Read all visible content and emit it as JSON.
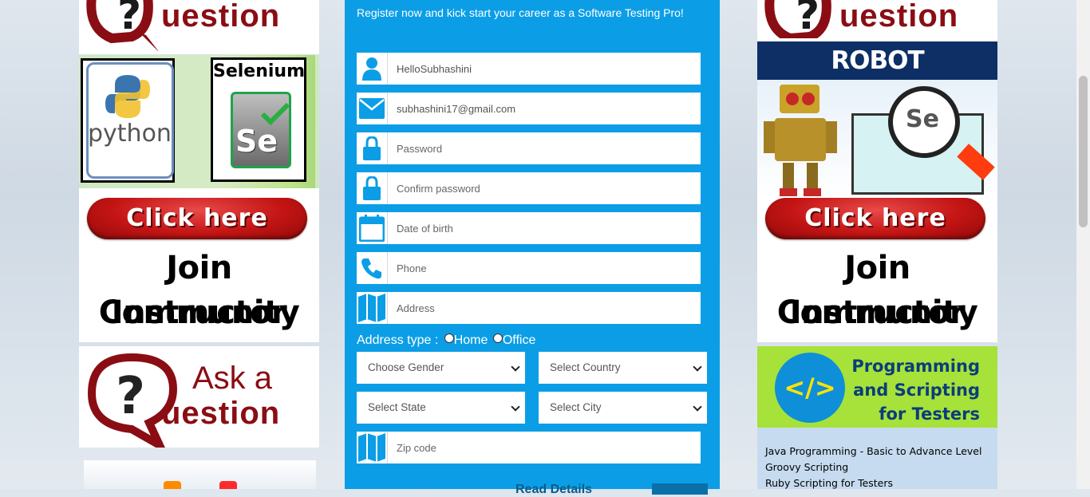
{
  "form": {
    "tagline": "Register now and kick start your career as a Software Testing Pro!",
    "fields": [
      {
        "icon": "user-icon",
        "value": "HelloSubhashini",
        "placeholder": ""
      },
      {
        "icon": "envelope-icon",
        "value": "subhashini17@gmail.com",
        "placeholder": ""
      },
      {
        "icon": "lock-icon",
        "value": "",
        "placeholder": "Password"
      },
      {
        "icon": "lock-icon",
        "value": "",
        "placeholder": "Confirm password"
      },
      {
        "icon": "calendar-icon",
        "value": "",
        "placeholder": "Date of birth"
      },
      {
        "icon": "phone-icon",
        "value": "",
        "placeholder": "Phone"
      },
      {
        "icon": "map-icon",
        "value": "",
        "placeholder": "Address"
      }
    ],
    "address_type": {
      "label": "Address type : ",
      "home": "Home",
      "office": "Office"
    },
    "selects": {
      "gender": "Choose Gender",
      "country": "Select Country",
      "state": "Select State",
      "city": "Select City"
    },
    "zip": {
      "icon": "map-icon",
      "placeholder": "Zip code"
    },
    "submit_text": "Read Details"
  },
  "ads": {
    "question_word": "uestion",
    "ask_a": "Ask a",
    "python_label": "python",
    "selenium_label": "Selenium",
    "se_label": "Se",
    "robot_label": "ROBOT FRAMEWORK",
    "click_label": "Click here",
    "join_line1": "Join Instructor",
    "join_line2": "Community",
    "prog_title_1": "Programming",
    "prog_title_2": "and Scripting",
    "prog_title_3": "for Testers",
    "prog_list": [
      "Java Programming - Basic to Advance Level",
      "Groovy Scripting",
      "Ruby Scripting for Testers"
    ]
  },
  "colors": {
    "panel": "#0b9ee6",
    "accent_red": "#8b0d14",
    "lime": "#a6e23a"
  }
}
